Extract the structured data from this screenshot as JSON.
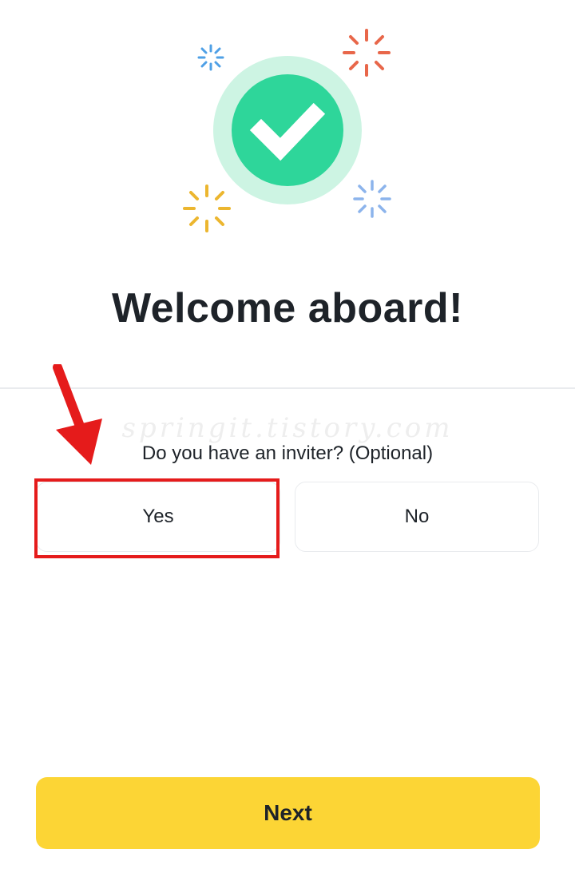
{
  "hero": {
    "icon": "success-check-icon",
    "accent_colors": {
      "check_circle": "#2ed69a",
      "check_halo": "#cdf4e3",
      "sparkle_blue": "#4fa0e6",
      "sparkle_orange": "#e8674a",
      "sparkle_yellow": "#ecb62f",
      "sparkle_light_blue": "#8cb4ec"
    }
  },
  "main": {
    "title": "Welcome aboard!",
    "question": "Do you have an inviter? (Optional)",
    "options": {
      "yes_label": "Yes",
      "no_label": "No"
    }
  },
  "footer": {
    "next_label": "Next",
    "next_color": "#fcd535"
  },
  "overlay": {
    "watermark": "springit.tistory.com",
    "annotation_color": "#e51b1b",
    "arrow_icon": "red-arrow-down-icon"
  }
}
